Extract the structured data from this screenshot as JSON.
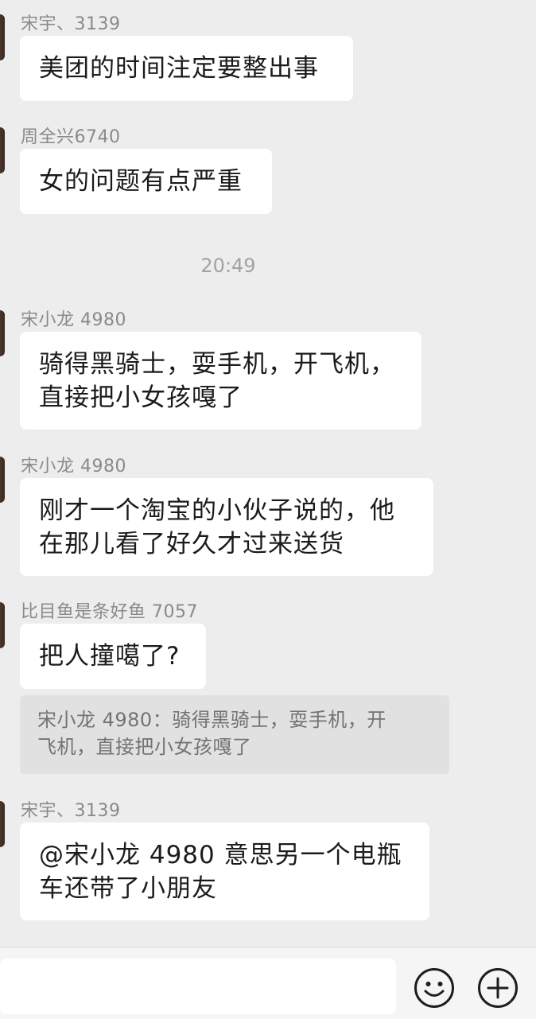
{
  "messages": [
    {
      "sender": "宋宇、3139",
      "lines": [
        "美团的时间注定要整出事"
      ]
    },
    {
      "sender": "周全兴6740",
      "lines": [
        "女的问题有点严重"
      ]
    },
    {
      "sender": "宋小龙 4980",
      "lines": [
        "骑得黑骑士，耍手机，开飞机，",
        "直接把小女孩嘎了"
      ]
    },
    {
      "sender": "宋小龙 4980",
      "lines": [
        "刚才一个淘宝的小伙子说的，他",
        "在那儿看了好久才过来送货"
      ]
    },
    {
      "sender": "比目鱼是条好鱼 7057",
      "lines": [
        "把人撞噶了?"
      ],
      "quote": [
        "宋小龙 4980：骑得黑骑士，耍手机，开",
        "飞机，直接把小女孩嘎了"
      ]
    },
    {
      "sender": "宋宇、3139",
      "lines": [
        "@宋小龙 4980 意思另一个电瓶",
        "车还带了小朋友"
      ]
    }
  ],
  "timestamp": "20:49",
  "input": {
    "value": "",
    "placeholder": ""
  },
  "icons": {
    "emoji": "emoji-icon",
    "more": "plus-circle-icon"
  }
}
